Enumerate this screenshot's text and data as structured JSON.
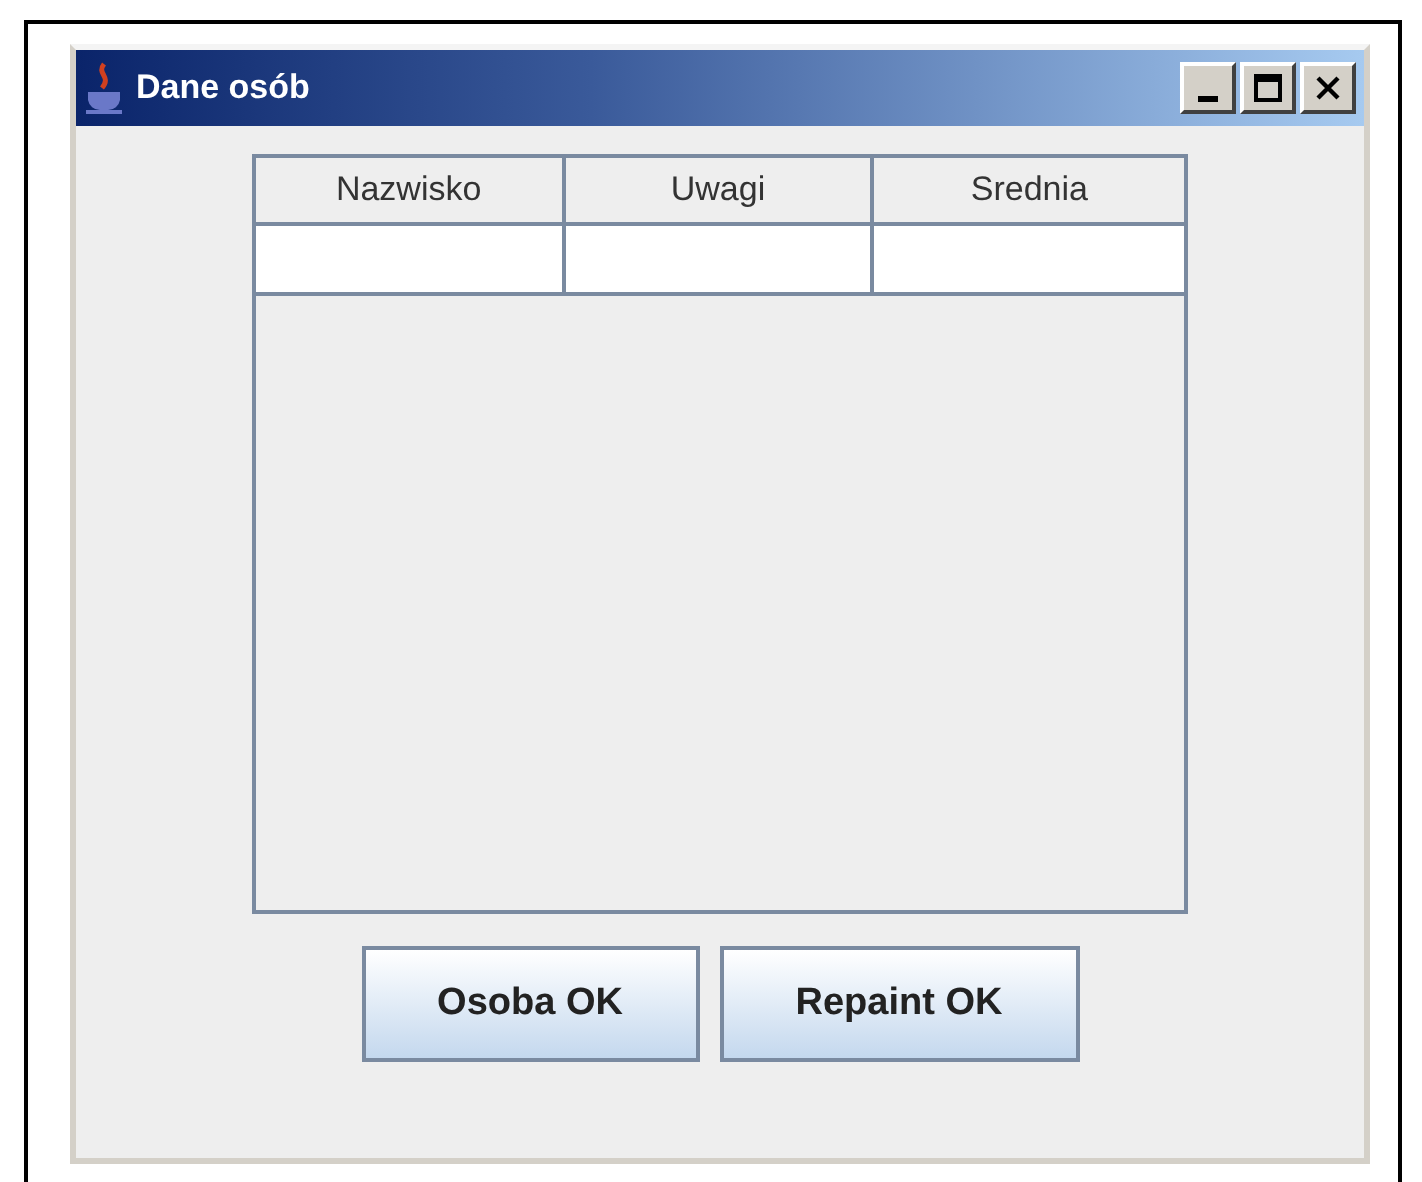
{
  "window": {
    "title": "Dane osób"
  },
  "table": {
    "columns": [
      "Nazwisko",
      "Uwagi",
      "Srednia"
    ]
  },
  "buttons": [
    "Osoba OK",
    "Repaint OK"
  ]
}
